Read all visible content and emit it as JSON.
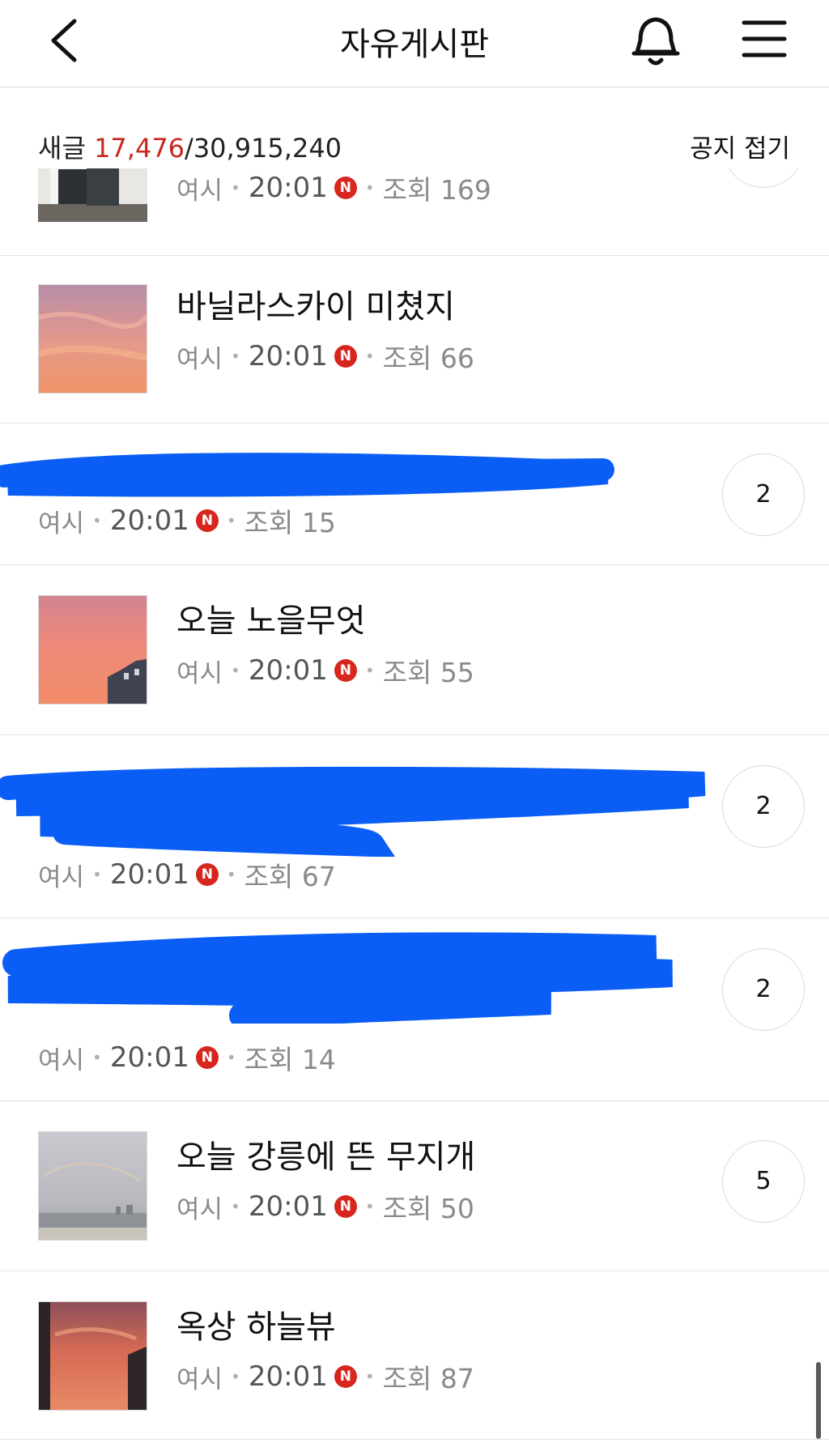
{
  "header": {
    "title": "자유게시판",
    "back_icon": "chevron-left-icon",
    "bell_icon": "bell-icon",
    "menu_icon": "hamburger-menu-icon"
  },
  "subbar": {
    "label": "새글",
    "new_count": "17,476",
    "total": "/30,915,240",
    "notice_toggle": "공지 접기"
  },
  "colors": {
    "accent_red": "#c8281e",
    "redaction_blue": "#0a5ef5"
  },
  "posts": [
    {
      "title": "",
      "author": "여시",
      "time": "20:01",
      "badge": "N",
      "views": "조회 169",
      "comments": ""
    },
    {
      "title": "바닐라스카이 미쳤지",
      "author": "여시",
      "time": "20:01",
      "badge": "N",
      "views": "조회 66",
      "comments": ""
    },
    {
      "title": "",
      "author": "여시",
      "time": "20:01",
      "badge": "N",
      "views": "조회 15",
      "comments": "2"
    },
    {
      "title": "오늘 노을무엇",
      "author": "여시",
      "time": "20:01",
      "badge": "N",
      "views": "조회 55",
      "comments": ""
    },
    {
      "title": "",
      "author": "여시",
      "time": "20:01",
      "badge": "N",
      "views": "조회 67",
      "comments": "2"
    },
    {
      "title": "",
      "author": "여시",
      "time": "20:01",
      "badge": "N",
      "views": "조회 14",
      "comments": "2"
    },
    {
      "title": "오늘 강릉에 뜬 무지개",
      "author": "여시",
      "time": "20:01",
      "badge": "N",
      "views": "조회 50",
      "comments": "5"
    },
    {
      "title": "옥상 하늘뷰",
      "author": "여시",
      "time": "20:01",
      "badge": "N",
      "views": "조회 87",
      "comments": ""
    }
  ]
}
